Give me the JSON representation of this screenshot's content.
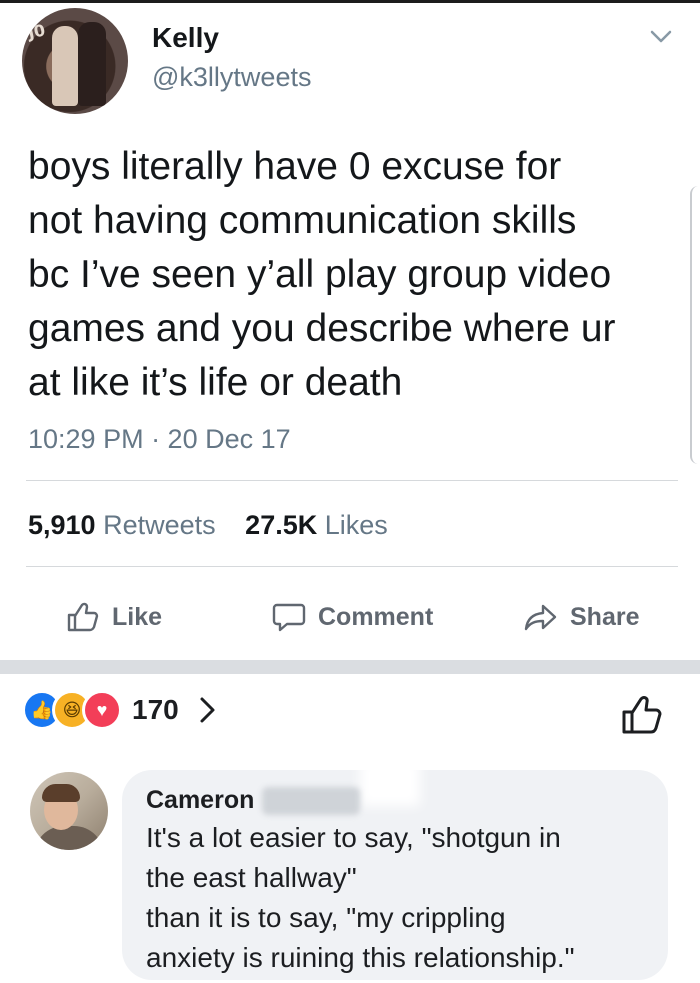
{
  "tweet": {
    "display_name": "Kelly",
    "handle": "@k3llytweets",
    "text": "boys literally have 0 excuse for\nnot having communication skills\nbc I’ve seen y’all play group video\ngames and you describe where ur\nat like it’s life or death",
    "timestamp": "10:29 PM · 20 Dec 17",
    "retweets_count": "5,910",
    "retweets_label": "Retweets",
    "likes_count": "27.5K",
    "likes_label": "Likes"
  },
  "actions": {
    "like": "Like",
    "comment": "Comment",
    "share": "Share"
  },
  "reactions": {
    "count": "170",
    "icons": [
      "like-reaction-icon",
      "haha-reaction-icon",
      "love-reaction-icon"
    ]
  },
  "comment": {
    "author": "Cameron",
    "text": "It's a lot easier to say, \"shotgun in\nthe east hallway\"\nthan it is to say, \"my crippling\nanxiety is ruining this relationship.\""
  },
  "colors": {
    "text_primary": "#14171a",
    "text_secondary": "#657786",
    "fb_gray": "#606770",
    "fb_blue": "#1877f2",
    "divider": "#dadde1"
  }
}
